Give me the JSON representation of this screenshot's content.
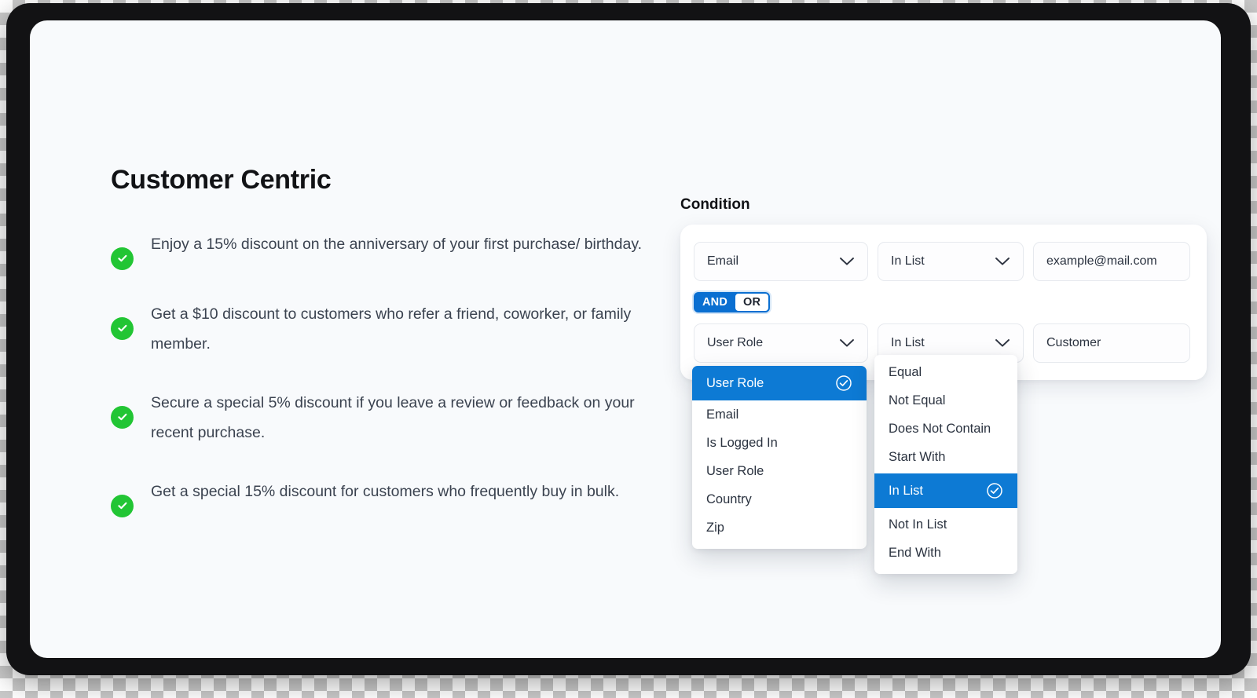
{
  "page": {
    "title": "Customer Centric",
    "benefits": [
      "Enjoy a 15% discount on the anniversary of your first purchase/ birthday.",
      "Get a $10 discount to customers who refer a friend, coworker, or family member.",
      "Secure a special 5% discount if you leave a review or feedback on your recent purchase.",
      "Get a special 15% discount for customers who frequently buy in bulk."
    ]
  },
  "condition": {
    "label": "Condition",
    "rows": [
      {
        "field": "Email",
        "operator": "In List",
        "value": "example@mail.com"
      },
      {
        "field": "User Role",
        "operator": "In List",
        "value": "Customer"
      }
    ],
    "logic_toggle": {
      "and_label": "AND",
      "or_label": "OR",
      "selected": "AND"
    }
  },
  "field_menu": {
    "selected": "User Role",
    "options": [
      "Email",
      "Is Logged In",
      "User Role",
      "Country",
      "Zip"
    ]
  },
  "operator_menu": {
    "options_before": [
      "Equal",
      "Not Equal",
      "Does Not Contain",
      "Start With"
    ],
    "selected": "In List",
    "options_after": [
      "Not In List",
      "End With"
    ]
  },
  "colors": {
    "accent_blue": "#0d7ad4",
    "toggle_blue": "#0a6fd1",
    "check_green": "#22c534",
    "card_bg": "#f8fafc",
    "frame": "#121214"
  }
}
